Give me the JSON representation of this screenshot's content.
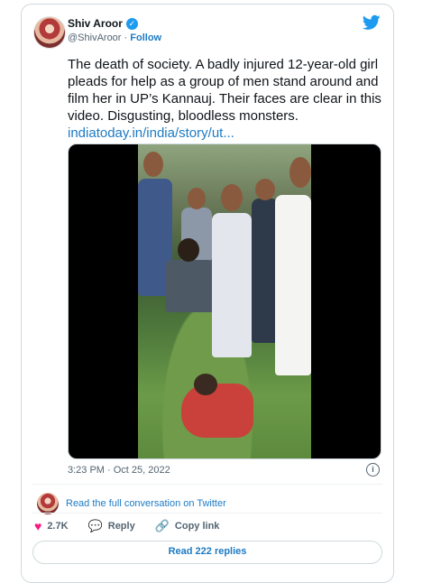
{
  "tweet": {
    "author_name": "Shiv Aroor",
    "handle": "@ShivAroor",
    "separator": "·",
    "follow_label": "Follow",
    "text": "The death of society. A badly injured 12-year-old girl pleads for help as a group of men stand around and film her in UP’s Kannauj. Their faces are clear in this video. Disgusting, bloodless monsters.",
    "link_text": "indiatoday.in/india/story/ut...",
    "timestamp": "3:23 PM · Oct 25, 2022",
    "conversation_link": "Read the full conversation on Twitter",
    "likes": "2.7K",
    "reply_label": "Reply",
    "copy_link_label": "Copy link",
    "read_replies_label": "Read 222 replies"
  },
  "icons": {
    "verified": "verified-badge-icon",
    "brand": "twitter-bird-icon",
    "info": "info-icon",
    "like": "heart-icon",
    "reply": "speech-bubble-icon",
    "copy": "link-icon"
  },
  "colors": {
    "accent": "#1d9bf0",
    "link": "#1d7bc4",
    "like": "#f91880",
    "muted": "#536471",
    "border": "#cfd9de"
  }
}
